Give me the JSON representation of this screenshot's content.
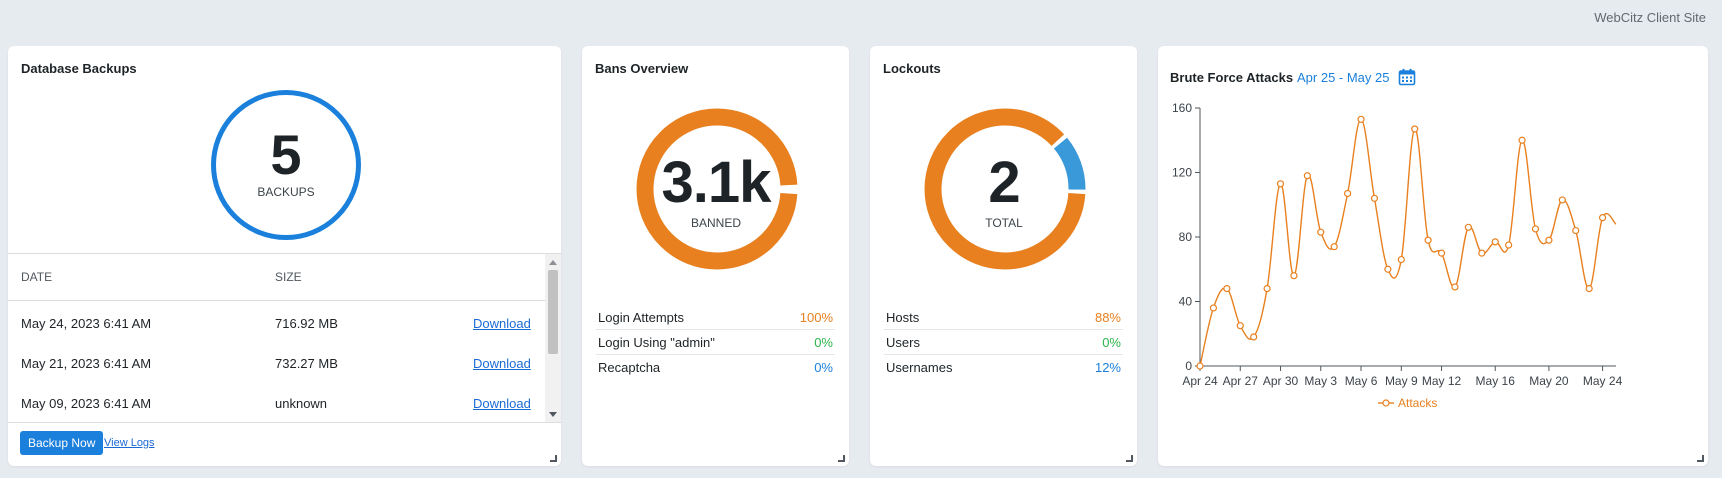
{
  "site_name": "WebCitz Client Site",
  "backups": {
    "title": "Database Backups",
    "count": "5",
    "count_label": "BACKUPS",
    "columns": {
      "date": "DATE",
      "size": "SIZE"
    },
    "rows": [
      {
        "date": "May 24, 2023 6:41 AM",
        "size": "716.92 MB",
        "action": "Download"
      },
      {
        "date": "May 21, 2023 6:41 AM",
        "size": "732.27 MB",
        "action": "Download"
      },
      {
        "date": "May 09, 2023 6:41 AM",
        "size": "unknown",
        "action": "Download"
      }
    ],
    "backup_button": "Backup Now",
    "logs_link": "View Logs",
    "ring_color": "#1b80db"
  },
  "bans": {
    "title": "Bans Overview",
    "value": "3.1k",
    "label": "BANNED",
    "donut_fraction": 0.99,
    "colors": {
      "primary": "#e8801f",
      "secondary": "#3a9ad9"
    },
    "stats": [
      {
        "label": "Login Attempts",
        "value": "100%",
        "color": "#e8801f"
      },
      {
        "label": "Login Using \"admin\"",
        "value": "0%",
        "color": "#2fb34a"
      },
      {
        "label": "Recaptcha",
        "value": "0%",
        "color": "#1b80db"
      }
    ]
  },
  "lockouts": {
    "title": "Lockouts",
    "value": "2",
    "label": "TOTAL",
    "donut_fraction": 0.88,
    "colors": {
      "primary": "#e8801f",
      "secondary": "#3a9ad9"
    },
    "stats": [
      {
        "label": "Hosts",
        "value": "88%",
        "color": "#e8801f"
      },
      {
        "label": "Users",
        "value": "0%",
        "color": "#2fb34a"
      },
      {
        "label": "Usernames",
        "value": "12%",
        "color": "#1b80db"
      }
    ]
  },
  "brute_force": {
    "title": "Brute Force Attacks",
    "date_range": "Apr 25 - May 25"
  },
  "chart_data": {
    "type": "line",
    "title": "Brute Force Attacks",
    "xlabel": "",
    "ylabel": "",
    "ylim": [
      0,
      160
    ],
    "yticks": [
      0,
      40,
      80,
      120,
      160
    ],
    "xtick_labels": [
      "Apr 24",
      "Apr 27",
      "Apr 30",
      "May 3",
      "May 6",
      "May 9",
      "May 12",
      "May 16",
      "May 20",
      "May 24"
    ],
    "xtick_index": [
      0,
      3,
      6,
      9,
      12,
      15,
      18,
      22,
      26,
      30
    ],
    "x": [
      "Apr 24",
      "Apr 25",
      "Apr 26",
      "Apr 27",
      "Apr 28",
      "Apr 29",
      "Apr 30",
      "May 1",
      "May 2",
      "May 3",
      "May 4",
      "May 5",
      "May 6",
      "May 7",
      "May 8",
      "May 9",
      "May 10",
      "May 11",
      "May 12",
      "May 13",
      "May 14",
      "May 15",
      "May 16",
      "May 17",
      "May 18",
      "May 19",
      "May 20",
      "May 21",
      "May 22",
      "May 23",
      "May 24",
      "May 25"
    ],
    "series": [
      {
        "name": "Attacks",
        "color": "#e8801f",
        "values": [
          0,
          36,
          48,
          25,
          18,
          48,
          113,
          56,
          118,
          83,
          74,
          107,
          153,
          104,
          60,
          66,
          147,
          78,
          70,
          49,
          86,
          70,
          77,
          75,
          140,
          85,
          78,
          103,
          84,
          48,
          92,
          88
        ]
      }
    ],
    "grid": false,
    "legend": "bottom"
  }
}
